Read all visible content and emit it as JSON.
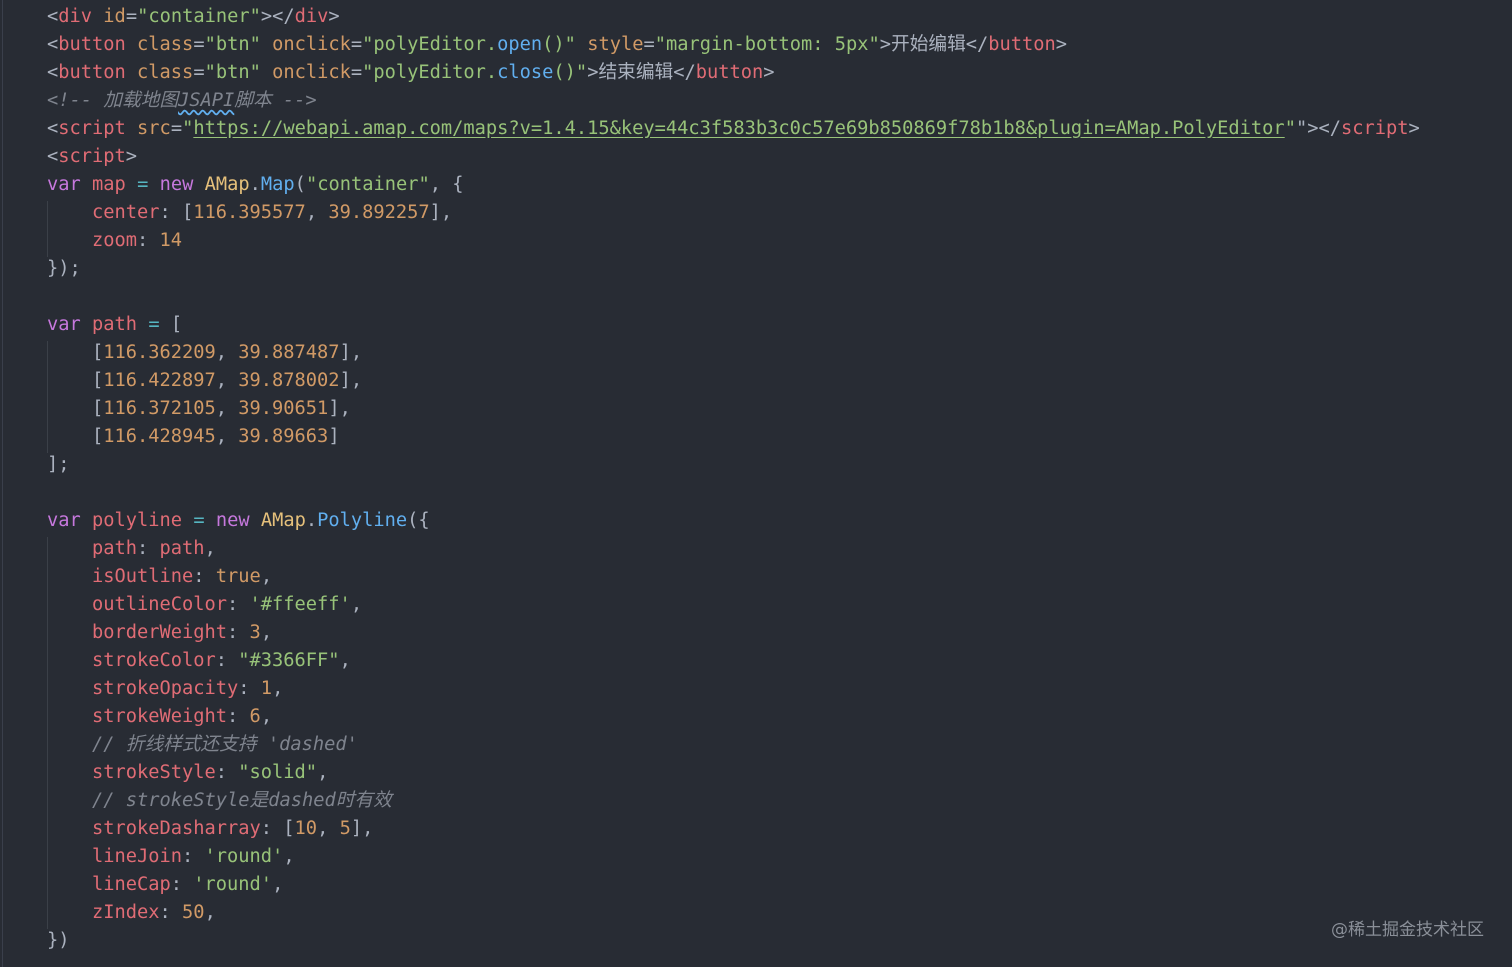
{
  "colors": {
    "background": "#282c34",
    "text": "#abb2bf",
    "tag": "#e06c75",
    "attribute": "#d19a66",
    "string": "#98c379",
    "keyword": "#c678dd",
    "property": "#e06c75",
    "number": "#d19a66",
    "class": "#e5c07b",
    "function": "#61afef",
    "operator": "#56b6c2",
    "comment": "#7f848e"
  },
  "lines": [
    [
      [
        "punct",
        "<"
      ],
      [
        "tag",
        "div"
      ],
      [
        "punct",
        " "
      ],
      [
        "attr",
        "id"
      ],
      [
        "punct",
        "="
      ],
      [
        "str",
        "\"container\""
      ],
      [
        "punct",
        "></"
      ],
      [
        "tag",
        "div"
      ],
      [
        "punct",
        ">"
      ]
    ],
    [
      [
        "punct",
        "<"
      ],
      [
        "tag",
        "button"
      ],
      [
        "punct",
        " "
      ],
      [
        "attr",
        "class"
      ],
      [
        "punct",
        "="
      ],
      [
        "str",
        "\"btn\""
      ],
      [
        "punct",
        " "
      ],
      [
        "attr",
        "onclick"
      ],
      [
        "punct",
        "="
      ],
      [
        "str",
        "\"polyEditor."
      ],
      [
        "fn",
        "open"
      ],
      [
        "str",
        "()\""
      ],
      [
        "punct",
        " "
      ],
      [
        "attr",
        "style"
      ],
      [
        "punct",
        "="
      ],
      [
        "str",
        "\"margin-bottom: 5px\""
      ],
      [
        "punct",
        ">开始编辑</"
      ],
      [
        "tag",
        "button"
      ],
      [
        "punct",
        ">"
      ]
    ],
    [
      [
        "punct",
        "<"
      ],
      [
        "tag",
        "button"
      ],
      [
        "punct",
        " "
      ],
      [
        "attr",
        "class"
      ],
      [
        "punct",
        "="
      ],
      [
        "str",
        "\"btn\""
      ],
      [
        "punct",
        " "
      ],
      [
        "attr",
        "onclick"
      ],
      [
        "punct",
        "="
      ],
      [
        "str",
        "\"polyEditor."
      ],
      [
        "fn",
        "close"
      ],
      [
        "str",
        "()\""
      ],
      [
        "punct",
        ">结束编辑</"
      ],
      [
        "tag",
        "button"
      ],
      [
        "punct",
        ">"
      ]
    ],
    [
      [
        "comment",
        "<!-- 加载地图"
      ],
      [
        "squiggle",
        "JSAPI"
      ],
      [
        "comment",
        "脚本 -->"
      ]
    ],
    [
      [
        "punct",
        "<"
      ],
      [
        "tag",
        "script"
      ],
      [
        "punct",
        " "
      ],
      [
        "attr",
        "src"
      ],
      [
        "punct",
        "="
      ],
      [
        "str",
        "\""
      ],
      [
        "url",
        "https://webapi.amap.com/maps?v=1.4.15&key=44c3f583b3c0c57e69b850869f78b1b8&plugin=AMap.PolyEditor"
      ],
      [
        "str",
        "\""
      ],
      [
        "punct",
        "\"></"
      ],
      [
        "tag",
        "script"
      ],
      [
        "punct",
        ">"
      ]
    ],
    [
      [
        "punct",
        "<"
      ],
      [
        "tag",
        "script"
      ],
      [
        "punct",
        ">"
      ]
    ],
    [
      [
        "kw",
        "var"
      ],
      [
        "punct",
        " "
      ],
      [
        "var",
        "map"
      ],
      [
        "punct",
        " "
      ],
      [
        "op",
        "="
      ],
      [
        "punct",
        " "
      ],
      [
        "kw",
        "new"
      ],
      [
        "punct",
        " "
      ],
      [
        "class",
        "AMap"
      ],
      [
        "punct",
        "."
      ],
      [
        "fn",
        "Map"
      ],
      [
        "punct",
        "("
      ],
      [
        "str",
        "\"container\""
      ],
      [
        "punct",
        ", {"
      ]
    ],
    [
      [
        "punct",
        "    "
      ],
      [
        "prop",
        "center"
      ],
      [
        "punct",
        ": ["
      ],
      [
        "num",
        "116.395577"
      ],
      [
        "punct",
        ", "
      ],
      [
        "num",
        "39.892257"
      ],
      [
        "punct",
        "],"
      ]
    ],
    [
      [
        "punct",
        "    "
      ],
      [
        "prop",
        "zoom"
      ],
      [
        "punct",
        ": "
      ],
      [
        "num",
        "14"
      ]
    ],
    [
      [
        "punct",
        "});"
      ]
    ],
    [
      [
        "punct",
        ""
      ]
    ],
    [
      [
        "kw",
        "var"
      ],
      [
        "punct",
        " "
      ],
      [
        "var",
        "path"
      ],
      [
        "punct",
        " "
      ],
      [
        "op",
        "="
      ],
      [
        "punct",
        " ["
      ]
    ],
    [
      [
        "punct",
        "    ["
      ],
      [
        "num",
        "116.362209"
      ],
      [
        "punct",
        ", "
      ],
      [
        "num",
        "39.887487"
      ],
      [
        "punct",
        "],"
      ]
    ],
    [
      [
        "punct",
        "    ["
      ],
      [
        "num",
        "116.422897"
      ],
      [
        "punct",
        ", "
      ],
      [
        "num",
        "39.878002"
      ],
      [
        "punct",
        "],"
      ]
    ],
    [
      [
        "punct",
        "    ["
      ],
      [
        "num",
        "116.372105"
      ],
      [
        "punct",
        ", "
      ],
      [
        "num",
        "39.90651"
      ],
      [
        "punct",
        "],"
      ]
    ],
    [
      [
        "punct",
        "    ["
      ],
      [
        "num",
        "116.428945"
      ],
      [
        "punct",
        ", "
      ],
      [
        "num",
        "39.89663"
      ],
      [
        "punct",
        "]"
      ]
    ],
    [
      [
        "punct",
        "];"
      ]
    ],
    [
      [
        "punct",
        ""
      ]
    ],
    [
      [
        "kw",
        "var"
      ],
      [
        "punct",
        " "
      ],
      [
        "var",
        "polyline"
      ],
      [
        "punct",
        " "
      ],
      [
        "op",
        "="
      ],
      [
        "punct",
        " "
      ],
      [
        "kw",
        "new"
      ],
      [
        "punct",
        " "
      ],
      [
        "class",
        "AMap"
      ],
      [
        "punct",
        "."
      ],
      [
        "fn",
        "Polyline"
      ],
      [
        "punct",
        "({"
      ]
    ],
    [
      [
        "punct",
        "    "
      ],
      [
        "prop",
        "path"
      ],
      [
        "punct",
        ": "
      ],
      [
        "var",
        "path"
      ],
      [
        "punct",
        ","
      ]
    ],
    [
      [
        "punct",
        "    "
      ],
      [
        "prop",
        "isOutline"
      ],
      [
        "punct",
        ": "
      ],
      [
        "bool",
        "true"
      ],
      [
        "punct",
        ","
      ]
    ],
    [
      [
        "punct",
        "    "
      ],
      [
        "prop",
        "outlineColor"
      ],
      [
        "punct",
        ": "
      ],
      [
        "str",
        "'#ffeeff'"
      ],
      [
        "punct",
        ","
      ]
    ],
    [
      [
        "punct",
        "    "
      ],
      [
        "prop",
        "borderWeight"
      ],
      [
        "punct",
        ": "
      ],
      [
        "num",
        "3"
      ],
      [
        "punct",
        ","
      ]
    ],
    [
      [
        "punct",
        "    "
      ],
      [
        "prop",
        "strokeColor"
      ],
      [
        "punct",
        ": "
      ],
      [
        "str",
        "\"#3366FF\""
      ],
      [
        "punct",
        ","
      ]
    ],
    [
      [
        "punct",
        "    "
      ],
      [
        "prop",
        "strokeOpacity"
      ],
      [
        "punct",
        ": "
      ],
      [
        "num",
        "1"
      ],
      [
        "punct",
        ","
      ]
    ],
    [
      [
        "punct",
        "    "
      ],
      [
        "prop",
        "strokeWeight"
      ],
      [
        "punct",
        ": "
      ],
      [
        "num",
        "6"
      ],
      [
        "punct",
        ","
      ]
    ],
    [
      [
        "punct",
        "    "
      ],
      [
        "comment",
        "// 折线样式还支持 'dashed'"
      ]
    ],
    [
      [
        "punct",
        "    "
      ],
      [
        "prop",
        "strokeStyle"
      ],
      [
        "punct",
        ": "
      ],
      [
        "str",
        "\"solid\""
      ],
      [
        "punct",
        ","
      ]
    ],
    [
      [
        "punct",
        "    "
      ],
      [
        "comment",
        "// strokeStyle是dashed时有效"
      ]
    ],
    [
      [
        "punct",
        "    "
      ],
      [
        "prop",
        "strokeDasharray"
      ],
      [
        "punct",
        ": ["
      ],
      [
        "num",
        "10"
      ],
      [
        "punct",
        ", "
      ],
      [
        "num",
        "5"
      ],
      [
        "punct",
        "],"
      ]
    ],
    [
      [
        "punct",
        "    "
      ],
      [
        "prop",
        "lineJoin"
      ],
      [
        "punct",
        ": "
      ],
      [
        "str",
        "'round'"
      ],
      [
        "punct",
        ","
      ]
    ],
    [
      [
        "punct",
        "    "
      ],
      [
        "prop",
        "lineCap"
      ],
      [
        "punct",
        ": "
      ],
      [
        "str",
        "'round'"
      ],
      [
        "punct",
        ","
      ]
    ],
    [
      [
        "punct",
        "    "
      ],
      [
        "prop",
        "zIndex"
      ],
      [
        "punct",
        ": "
      ],
      [
        "num",
        "50"
      ],
      [
        "punct",
        ","
      ]
    ],
    [
      [
        "punct",
        "})"
      ]
    ]
  ],
  "watermark": "@稀土掘金技术社区"
}
